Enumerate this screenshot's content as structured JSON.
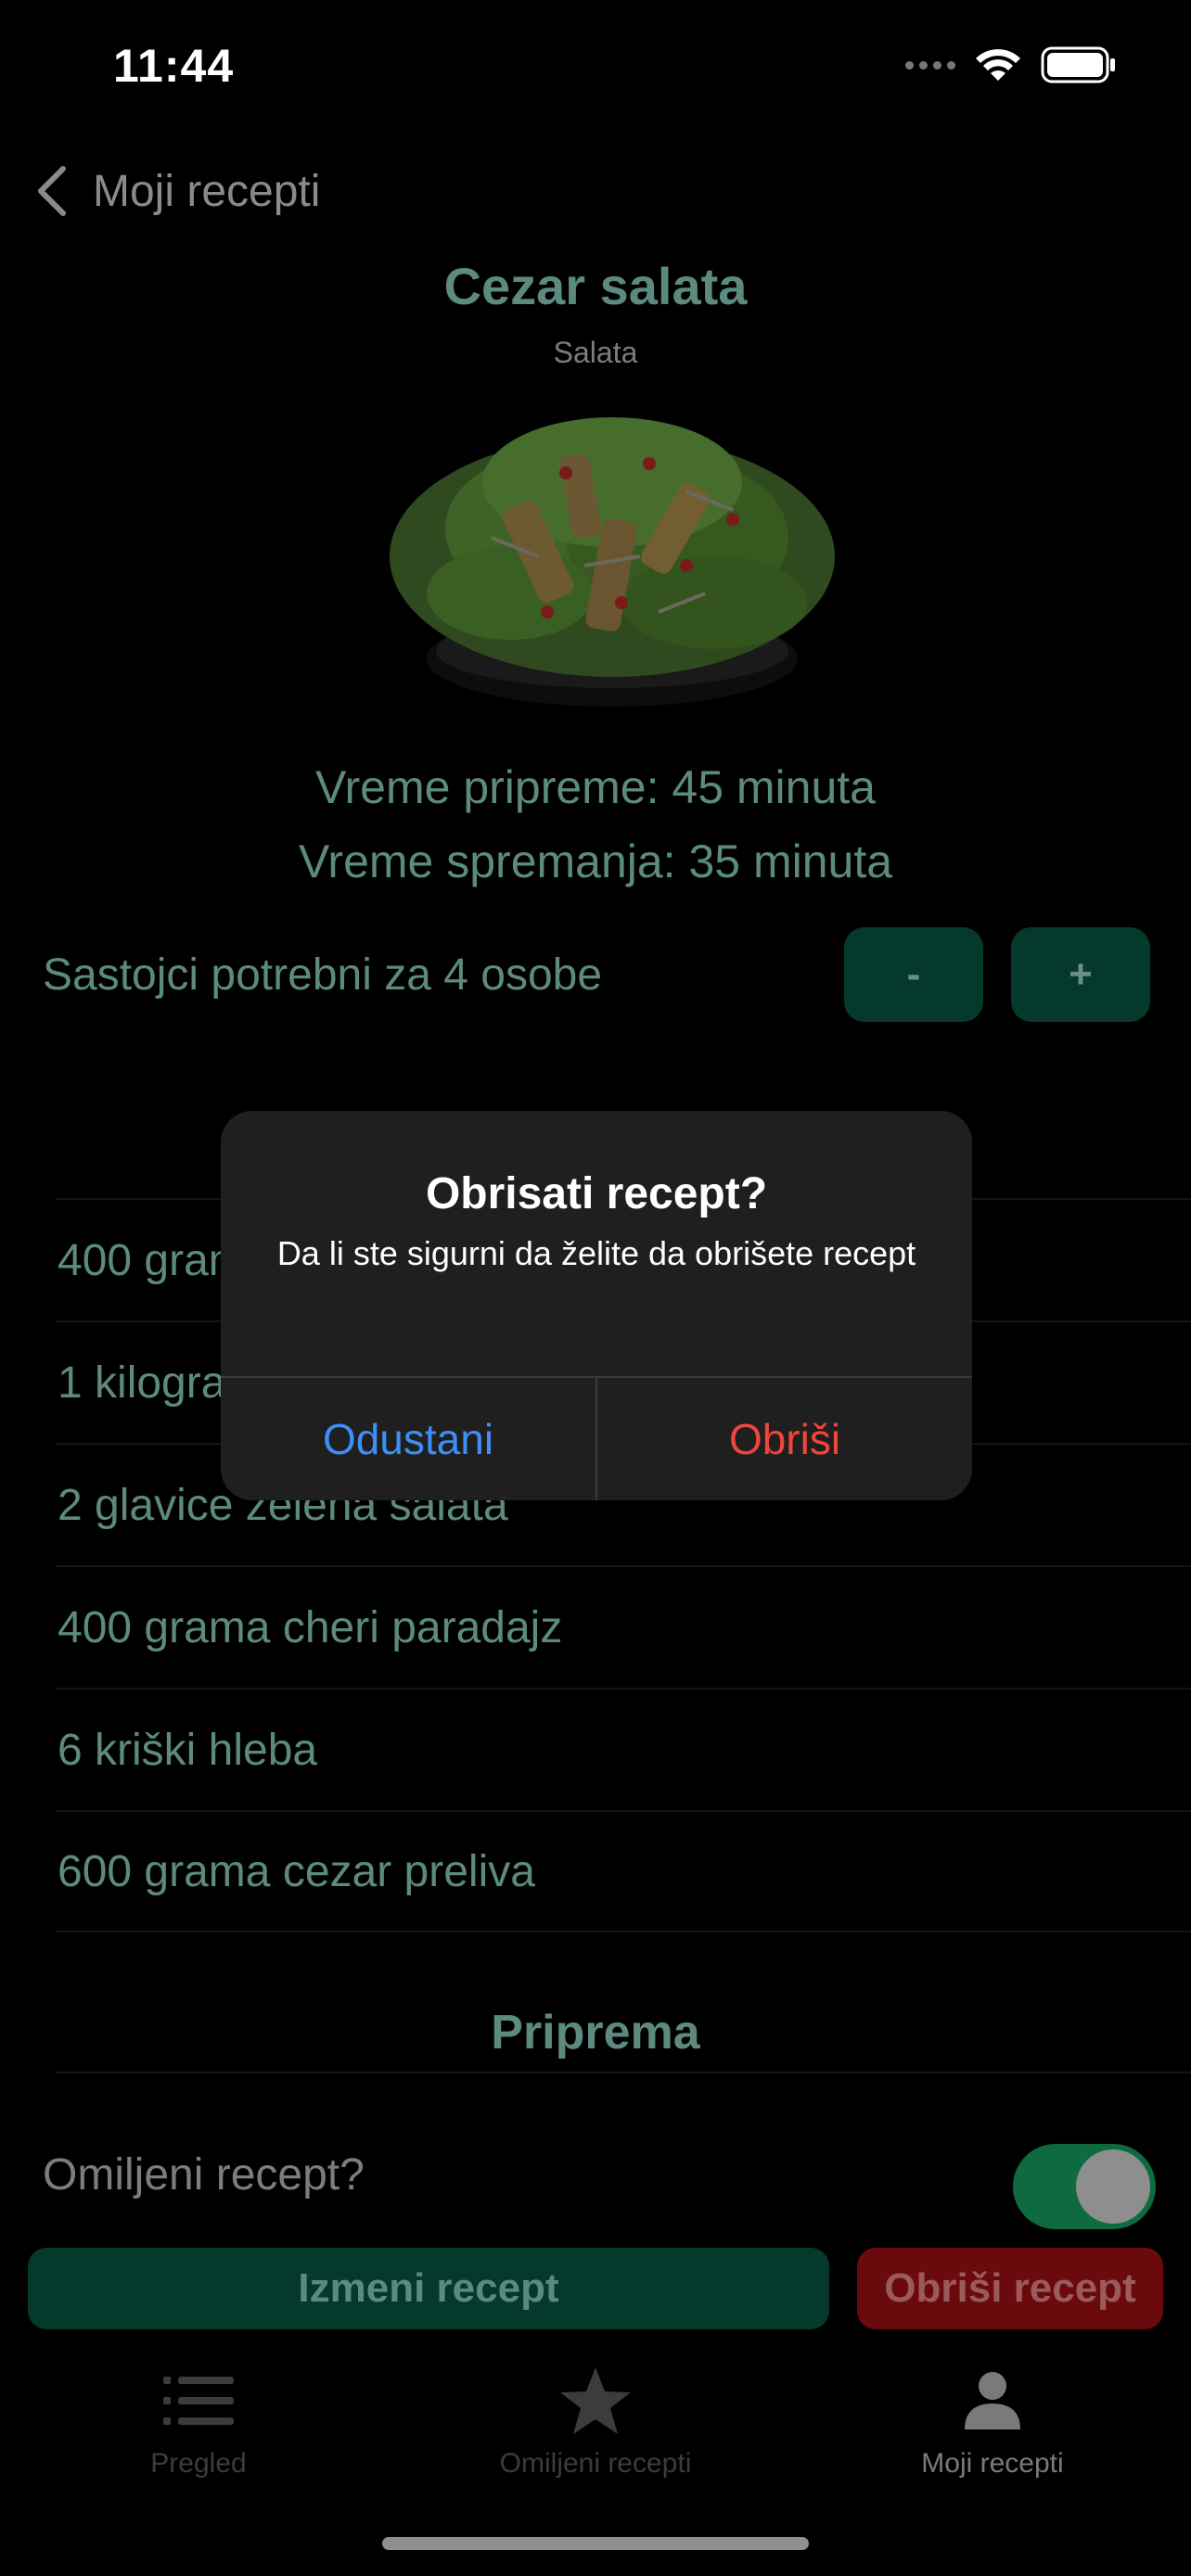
{
  "status_bar": {
    "time": "11:44"
  },
  "nav": {
    "back_label": "Moji recepti"
  },
  "recipe": {
    "title": "Cezar salata",
    "category": "Salata",
    "prep_time": "Vreme pripreme: 45 minuta",
    "cook_time": "Vreme spremanja: 35 minuta",
    "servings_label": "Sastojci potrebni za 4 osobe",
    "minus_label": "-",
    "plus_label": "+",
    "ingredients": [
      "400 grama piletine",
      "1 kilogram",
      "2 glavice zelena salata",
      "400 grama cheri paradajz",
      "6 kriški hleba",
      "600 grama cezar preliva"
    ],
    "preparation_title": "Priprema",
    "favorite_label": "Omiljeni recept?",
    "favorite_on": true,
    "edit_label": "Izmeni recept",
    "delete_label": "Obriši recept"
  },
  "tabs": [
    {
      "label": "Pregled",
      "icon": "list-icon"
    },
    {
      "label": "Omiljeni recepti",
      "icon": "star-icon"
    },
    {
      "label": "Moji recepti",
      "icon": "person-icon"
    }
  ],
  "alert": {
    "title": "Obrisati recept?",
    "message": "Da li ste sigurni da želite da obrišete recept",
    "cancel_label": "Odustani",
    "confirm_label": "Obriši"
  },
  "colors": {
    "accent_green": "#04392b",
    "danger_red": "#6b0a0c",
    "alert_cancel": "#3e8ef7",
    "alert_confirm": "#f0453a"
  }
}
